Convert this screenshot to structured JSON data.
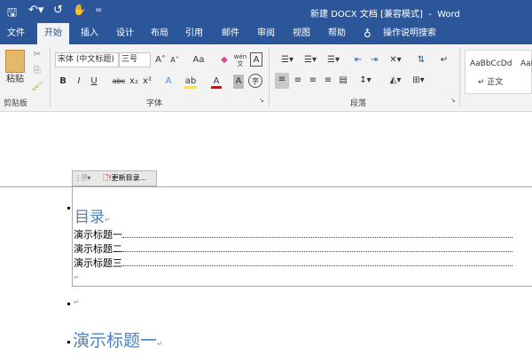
{
  "window": {
    "title": "新建 DOCX 文档 [兼容模式]  -  Word",
    "qat": {
      "save": "save-icon",
      "undo": "undo-icon",
      "redo": "redo-icon",
      "touch": "touch-mode-icon",
      "customize": "="
    }
  },
  "tabs": [
    {
      "label": "文件"
    },
    {
      "label": "开始",
      "active": true
    },
    {
      "label": "插入"
    },
    {
      "label": "设计"
    },
    {
      "label": "布局"
    },
    {
      "label": "引用"
    },
    {
      "label": "邮件"
    },
    {
      "label": "审阅"
    },
    {
      "label": "视图"
    },
    {
      "label": "帮助"
    }
  ],
  "tell_me": "操作说明搜索",
  "ribbon": {
    "clipboard": {
      "label": "剪贴板",
      "paste": "粘贴"
    },
    "font": {
      "label": "字体",
      "font_name": "宋体 (中文标题)",
      "font_size": "三号",
      "bold": "B",
      "italic": "I",
      "underline": "U",
      "strike": "abc",
      "sub": "x₂",
      "sup": "x²",
      "case": "Aa",
      "grow": "A˄",
      "shrink": "A˅",
      "phonetic": "wén 文",
      "border": "A",
      "effects": "A",
      "highlight": "ab",
      "color": "A",
      "shade": "A",
      "enclose": "字"
    },
    "paragraph": {
      "label": "段落"
    },
    "styles": {
      "sample1": "AaBbCcDd",
      "name1": "正文",
      "sample2": "AaB"
    }
  },
  "colors": {
    "accent": "#2b579a",
    "heading": "#4f81bd"
  },
  "document": {
    "toc_toolbar": {
      "update": "更新目录..."
    },
    "toc_title": "目录",
    "toc_entries": [
      "演示标题一",
      "演示标题二",
      "演示标题三"
    ],
    "heading1": "演示标题一",
    "para_mark": "↵"
  }
}
